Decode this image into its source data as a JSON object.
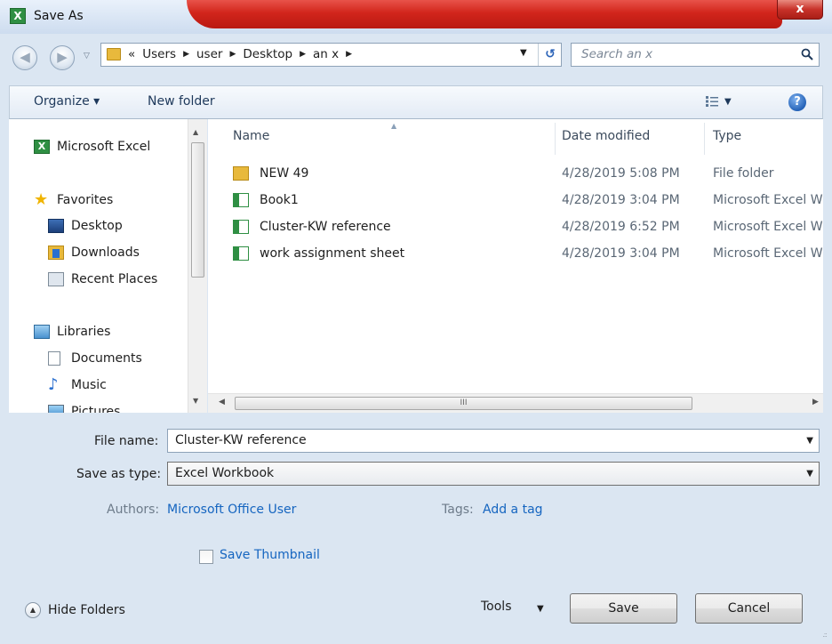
{
  "window": {
    "title": "Save As",
    "app_icon_letter": "X",
    "close_glyph": "x"
  },
  "address": {
    "breadcrumbs": [
      "«",
      "Users",
      "user",
      "Desktop",
      "an x"
    ],
    "search_placeholder": "Search an x"
  },
  "toolbar": {
    "organize_label": "Organize ▾",
    "new_folder_label": "New folder",
    "help_glyph": "?"
  },
  "nav_pane": {
    "items": [
      {
        "label": "Microsoft Excel",
        "icon": "excel-icon"
      },
      {
        "label": "Favorites",
        "icon": "star-icon"
      },
      {
        "label": "Desktop",
        "icon": "desktop-icon"
      },
      {
        "label": "Downloads",
        "icon": "downloads-folder-icon"
      },
      {
        "label": "Recent Places",
        "icon": "recent-places-icon"
      },
      {
        "label": "Libraries",
        "icon": "libraries-icon"
      },
      {
        "label": "Documents",
        "icon": "document-icon"
      },
      {
        "label": "Music",
        "icon": "music-icon"
      },
      {
        "label": "Pictures",
        "icon": "pictures-icon"
      }
    ]
  },
  "file_list": {
    "columns": [
      "Name",
      "Date modified",
      "Type"
    ],
    "rows": [
      {
        "name": "NEW 49",
        "date": "4/28/2019 5:08 PM",
        "type": "File folder",
        "icon": "folder-icon"
      },
      {
        "name": "Book1",
        "date": "4/28/2019 3:04 PM",
        "type": "Microsoft Excel W",
        "icon": "excel-file-icon"
      },
      {
        "name": "Cluster-KW reference",
        "date": "4/28/2019 6:52 PM",
        "type": "Microsoft Excel W",
        "icon": "excel-file-icon"
      },
      {
        "name": "work assignment sheet",
        "date": "4/28/2019 3:04 PM",
        "type": "Microsoft Excel W",
        "icon": "excel-file-icon"
      }
    ],
    "scroll_grip": "III"
  },
  "form": {
    "file_name_label": "File name:",
    "file_name_value": "Cluster-KW reference",
    "save_type_label": "Save as type:",
    "save_type_value": "Excel Workbook",
    "authors_label": "Authors:",
    "authors_value": "Microsoft Office User",
    "tags_label": "Tags:",
    "tags_value": "Add a tag",
    "thumbnail_label": "Save Thumbnail"
  },
  "footer": {
    "hide_folders_label": "Hide Folders",
    "tools_label": "Tools",
    "save_label": "Save",
    "cancel_label": "Cancel"
  },
  "colors": {
    "accent_link": "#1565c0",
    "title_red": "#d11b10",
    "excel_green": "#2f8f43",
    "folder_yellow": "#e8b93c"
  }
}
